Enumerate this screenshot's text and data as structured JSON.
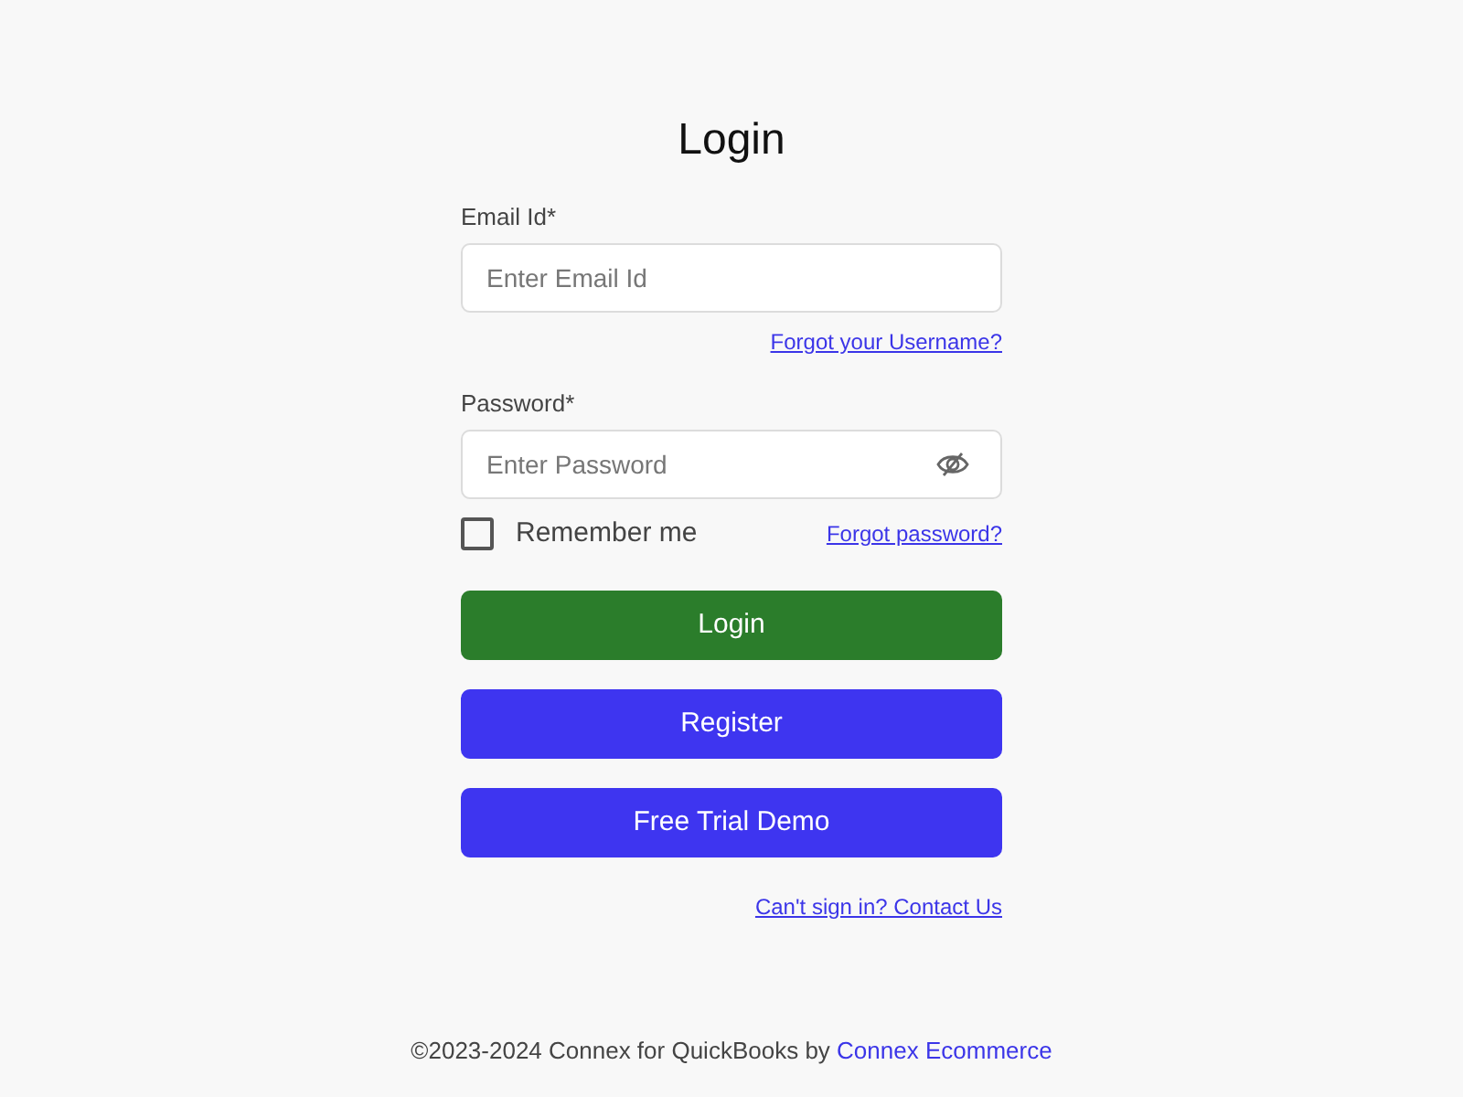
{
  "title": "Login",
  "email": {
    "label": "Email Id*",
    "placeholder": "Enter Email Id"
  },
  "forgot_username_link": "Forgot your Username?",
  "password": {
    "label": "Password*",
    "placeholder": "Enter Password"
  },
  "remember_me": {
    "label": "Remember me",
    "checked": false
  },
  "forgot_password_link": "Forgot password?",
  "buttons": [
    {
      "label": "Login",
      "kind": "primary"
    },
    {
      "label": "Register",
      "kind": "secondary"
    },
    {
      "label": "Free Trial Demo",
      "kind": "secondary"
    }
  ],
  "contact_link": "Can't sign in? Contact Us",
  "footer": {
    "text": "©2023-2024 Connex for QuickBooks by",
    "link": "Connex Ecommerce"
  }
}
